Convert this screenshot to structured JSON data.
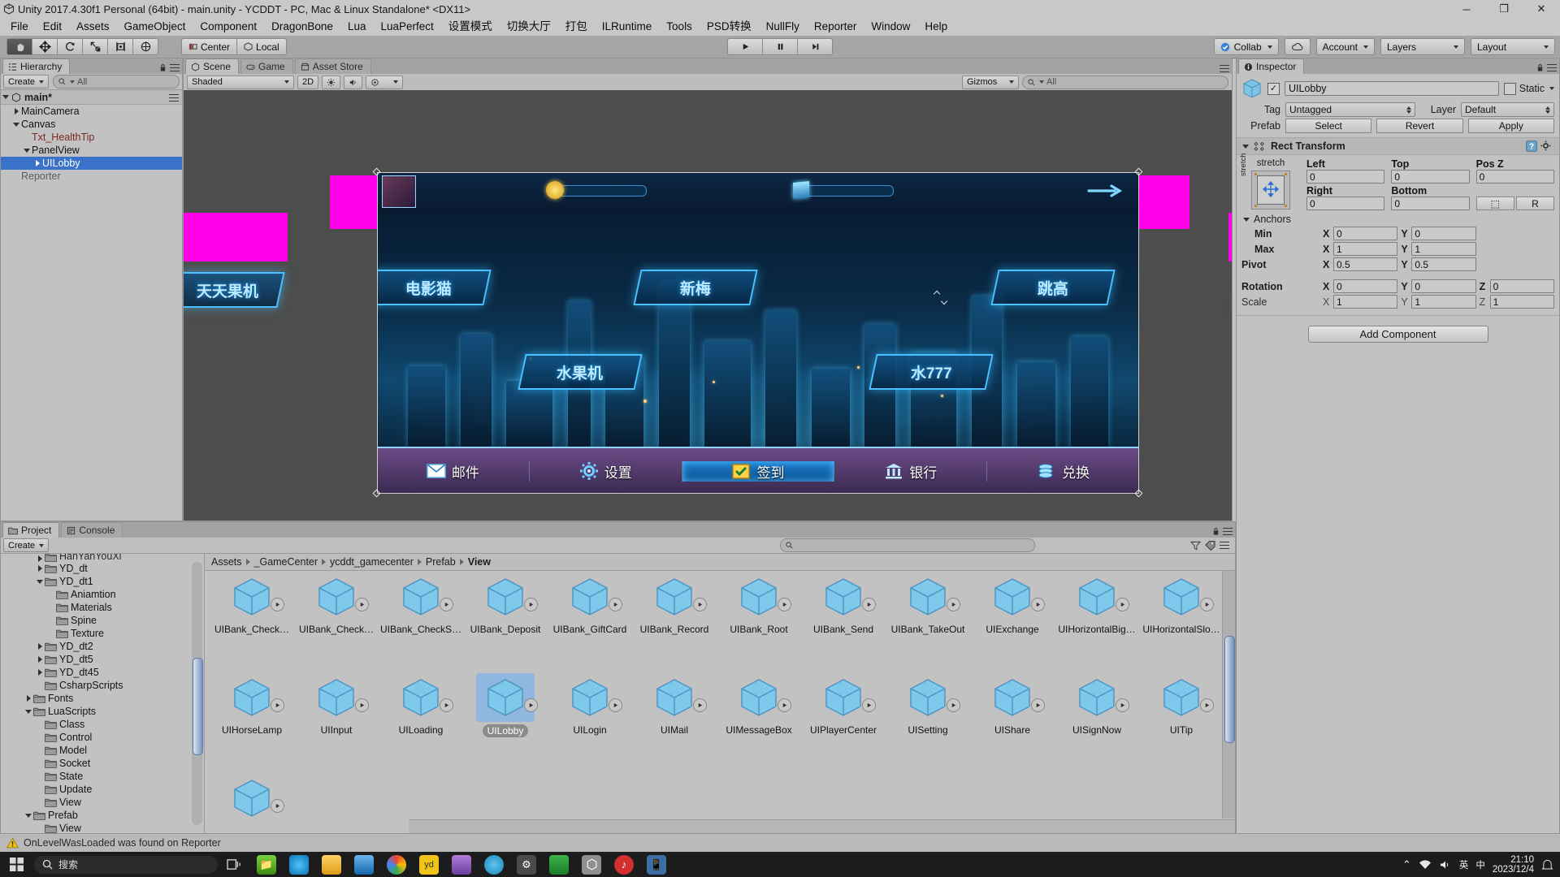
{
  "window": {
    "title": "Unity 2017.4.30f1 Personal (64bit) - main.unity - YCDDT - PC, Mac & Linux Standalone* <DX11>",
    "minimize": "─",
    "maximize": "❐",
    "close": "✕"
  },
  "menu": {
    "items": [
      "File",
      "Edit",
      "Assets",
      "GameObject",
      "Component",
      "DragonBone",
      "Lua",
      "LuaPerfect",
      "设置模式",
      "切换大厅",
      "打包",
      "ILRuntime",
      "Tools",
      "PSD转换",
      "NullFly",
      "Reporter",
      "Window",
      "Help"
    ]
  },
  "toolbar": {
    "tools": [
      "hand-tool",
      "move-tool",
      "rotate-tool",
      "scale-tool",
      "rect-tool",
      "transform-tool"
    ],
    "active_tool": "hand-tool",
    "pivot_mode": "Center",
    "pivot_rotation": "Local",
    "play": "▶",
    "pause": "❙❙",
    "step": "▶❙",
    "collab": "Collab",
    "cloud": "cloud-icon",
    "account": "Account",
    "layers": "Layers",
    "layout": "Layout"
  },
  "hierarchy": {
    "tab": "Hierarchy",
    "create": "Create",
    "search_placeholder": "All",
    "scene_name": "main*",
    "items": [
      {
        "label": "MainCamera",
        "depth": 1,
        "arrow": "closed",
        "style": "normal"
      },
      {
        "label": "Canvas",
        "depth": 1,
        "arrow": "open",
        "style": "normal"
      },
      {
        "label": "Txt_HealthTip",
        "depth": 2,
        "arrow": "none",
        "style": "red"
      },
      {
        "label": "PanelView",
        "depth": 2,
        "arrow": "open",
        "style": "normal"
      },
      {
        "label": "UILobby",
        "depth": 3,
        "arrow": "closed",
        "style": "selected"
      },
      {
        "label": "Reporter",
        "depth": 1,
        "arrow": "none",
        "style": "dim"
      }
    ]
  },
  "scene": {
    "tabs": [
      {
        "label": "Scene",
        "icon": "scene-icon",
        "active": true
      },
      {
        "label": "Game",
        "icon": "game-icon",
        "active": false
      },
      {
        "label": "Asset Store",
        "icon": "store-icon",
        "active": false
      }
    ],
    "draw_mode": "Shaded",
    "two_d": "2D",
    "lighting": "lighting-icon",
    "audio": "audio-icon",
    "effects": "effects-icon",
    "gizmos": "Gizmos",
    "search_placeholder": "All"
  },
  "game_mock": {
    "top_icons": [
      "coin-icon",
      "diamond-icon",
      "arrow-right-icon"
    ],
    "bottom_buttons": [
      {
        "label": "邮件",
        "icon": "mail-icon",
        "highlighted": false
      },
      {
        "label": "设置",
        "icon": "gear-icon",
        "highlighted": false
      },
      {
        "label": "签到",
        "icon": "checkin-icon",
        "highlighted": true
      },
      {
        "label": "银行",
        "icon": "bank-icon",
        "highlighted": false
      },
      {
        "label": "兑换",
        "icon": "exchange-icon",
        "highlighted": false
      }
    ],
    "game_tags": [
      "电影猫",
      "新梅",
      "跳高",
      "水果机",
      "水777",
      "天天果机"
    ]
  },
  "inspector": {
    "tab": "Inspector",
    "object_name": "UILobby",
    "enabled": true,
    "static_label": "Static",
    "tag_label": "Tag",
    "tag_value": "Untagged",
    "layer_label": "Layer",
    "layer_value": "Default",
    "prefab_label": "Prefab",
    "prefab_select": "Select",
    "prefab_revert": "Revert",
    "prefab_apply": "Apply",
    "component": {
      "title": "Rect Transform",
      "anchor_preset": "stretch",
      "anchor_preset_side": "stretch",
      "headers": {
        "left": "Left",
        "top": "Top",
        "posz": "Pos Z",
        "right": "Right",
        "bottom": "Bottom"
      },
      "values": {
        "left": "0",
        "top": "0",
        "posz": "0",
        "right": "0",
        "bottom": "0"
      },
      "blueprint": "⬚",
      "raw": "R",
      "anchors_label": "Anchors",
      "min_label": "Min",
      "max_label": "Max",
      "pivot_label": "Pivot",
      "rotation_label": "Rotation",
      "scale_label": "Scale",
      "axis_x": "X",
      "axis_y": "Y",
      "axis_z": "Z",
      "min": {
        "x": "0",
        "y": "0"
      },
      "max": {
        "x": "1",
        "y": "1"
      },
      "pivot": {
        "x": "0.5",
        "y": "0.5"
      },
      "rotation": {
        "x": "0",
        "y": "0",
        "z": "0"
      },
      "scale": {
        "x": "1",
        "y": "1",
        "z": "1"
      }
    },
    "add_component": "Add Component"
  },
  "project": {
    "tabs": [
      {
        "label": "Project",
        "icon": "folder-icon",
        "active": true
      },
      {
        "label": "Console",
        "icon": "console-icon",
        "active": false
      }
    ],
    "create": "Create",
    "search_placeholder": "",
    "breadcrumb": [
      "Assets",
      "_GameCenter",
      "ycddt_gamecenter",
      "Prefab",
      "View"
    ],
    "tree": [
      {
        "label": "HanYanYouXi",
        "depth": 3,
        "arrow": "closed",
        "clipped": true
      },
      {
        "label": "YD_dt",
        "depth": 3,
        "arrow": "closed"
      },
      {
        "label": "YD_dt1",
        "depth": 3,
        "arrow": "open"
      },
      {
        "label": "Aniamtion",
        "depth": 4,
        "arrow": "none"
      },
      {
        "label": "Materials",
        "depth": 4,
        "arrow": "none"
      },
      {
        "label": "Spine",
        "depth": 4,
        "arrow": "none"
      },
      {
        "label": "Texture",
        "depth": 4,
        "arrow": "none"
      },
      {
        "label": "YD_dt2",
        "depth": 3,
        "arrow": "closed"
      },
      {
        "label": "YD_dt5",
        "depth": 3,
        "arrow": "closed"
      },
      {
        "label": "YD_dt45",
        "depth": 3,
        "arrow": "closed"
      },
      {
        "label": "CsharpScripts",
        "depth": 3,
        "arrow": "none"
      },
      {
        "label": "Fonts",
        "depth": 2,
        "arrow": "closed"
      },
      {
        "label": "LuaScripts",
        "depth": 2,
        "arrow": "open"
      },
      {
        "label": "Class",
        "depth": 3,
        "arrow": "none"
      },
      {
        "label": "Control",
        "depth": 3,
        "arrow": "none"
      },
      {
        "label": "Model",
        "depth": 3,
        "arrow": "none"
      },
      {
        "label": "Socket",
        "depth": 3,
        "arrow": "none"
      },
      {
        "label": "State",
        "depth": 3,
        "arrow": "none"
      },
      {
        "label": "Update",
        "depth": 3,
        "arrow": "none"
      },
      {
        "label": "View",
        "depth": 3,
        "arrow": "none"
      },
      {
        "label": "Prefab",
        "depth": 2,
        "arrow": "open"
      },
      {
        "label": "View",
        "depth": 3,
        "arrow": "none"
      }
    ],
    "assets": [
      {
        "label": "UIBank_Check…",
        "selected": false
      },
      {
        "label": "UIBank_Check…",
        "selected": false
      },
      {
        "label": "UIBank_CheckS…",
        "selected": false
      },
      {
        "label": "UIBank_Deposit",
        "selected": false
      },
      {
        "label": "UIBank_GiftCard",
        "selected": false
      },
      {
        "label": "UIBank_Record",
        "selected": false
      },
      {
        "label": "UIBank_Root",
        "selected": false
      },
      {
        "label": "UIBank_Send",
        "selected": false
      },
      {
        "label": "UIBank_TakeOut",
        "selected": false
      },
      {
        "label": "UIExchange",
        "selected": false
      },
      {
        "label": "UIHorizontalBig…",
        "selected": false
      },
      {
        "label": "UIHorizontalSlo…",
        "selected": false
      },
      {
        "label": "UIHorseLamp",
        "selected": false
      },
      {
        "label": "UIInput",
        "selected": false
      },
      {
        "label": "UILoading",
        "selected": false
      },
      {
        "label": "UILobby",
        "selected": true
      },
      {
        "label": "UILogin",
        "selected": false
      },
      {
        "label": "UIMail",
        "selected": false
      },
      {
        "label": "UIMessageBox",
        "selected": false
      },
      {
        "label": "UIPlayerCenter",
        "selected": false
      },
      {
        "label": "UISetting",
        "selected": false
      },
      {
        "label": "UIShare",
        "selected": false
      },
      {
        "label": "UISignNow",
        "selected": false
      },
      {
        "label": "UITip",
        "selected": false
      },
      {
        "label": "",
        "selected": false
      }
    ]
  },
  "status": {
    "message": "OnLevelWasLoaded was found on Reporter",
    "icon": "warning-icon"
  },
  "taskbar": {
    "start": "start-icon",
    "search_placeholder": "搜索",
    "apps": [
      "task-view-icon",
      "folder-app-icon",
      "edge-icon",
      "explorer-icon",
      "store-icon",
      "chrome-icon",
      "yd-icon",
      "telegram-icon",
      "app-icon",
      "settings-icon",
      "green-icon",
      "unity-icon",
      "music-icon",
      "phone-icon"
    ],
    "tray": {
      "chevron": "⌃",
      "network": "network-icon",
      "volume": "volume-icon",
      "ime": "英",
      "ime2": "中",
      "time": "21:10",
      "date": "2023/12/4",
      "notification": "notification-icon"
    }
  },
  "colors": {
    "panel": "#c2c2c2",
    "toolbar": "#a5a5a5",
    "selection_blue": "#3a72c9",
    "accent_cyan": "#49c0ff",
    "magenta": "#ff00e8"
  }
}
